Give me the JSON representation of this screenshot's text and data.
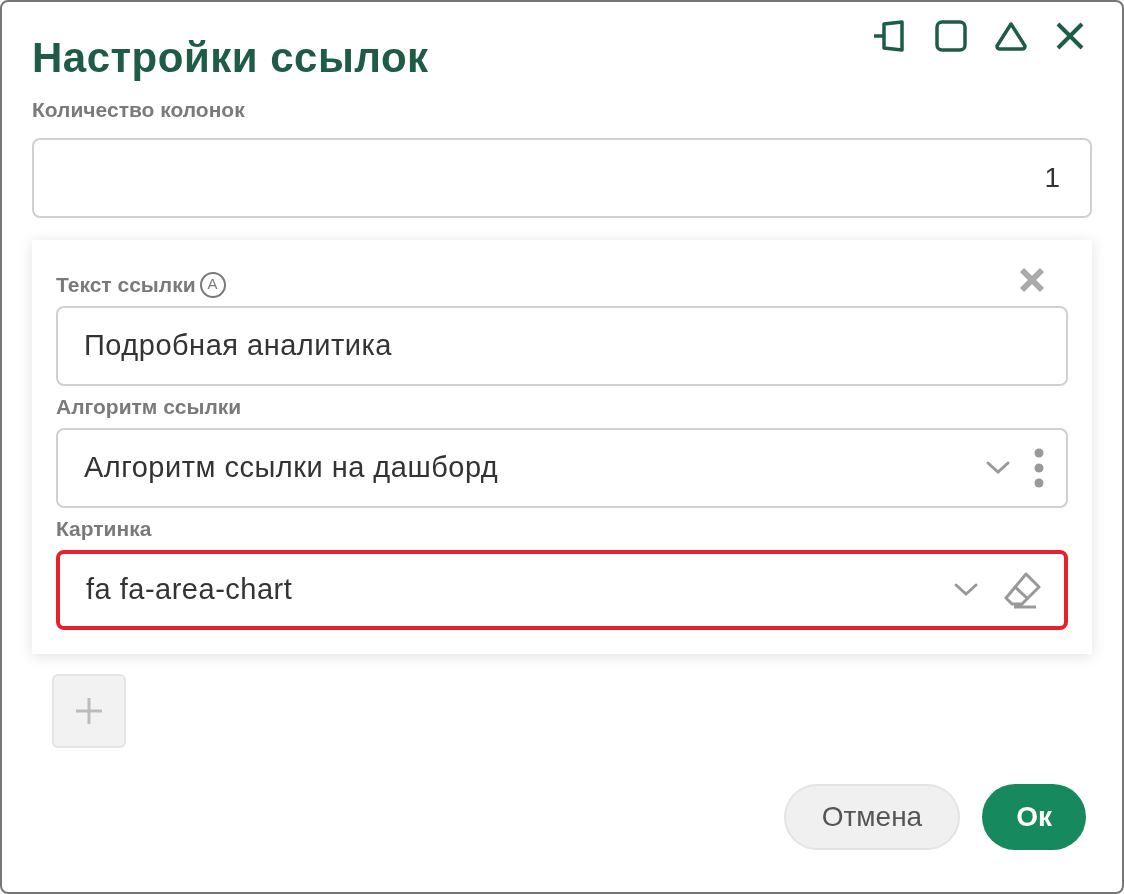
{
  "window": {
    "title": "Настройки ссылок"
  },
  "columns_field": {
    "label": "Количество колонок",
    "value": "1"
  },
  "link_card": {
    "fields": [
      {
        "kind": "text",
        "label": "Текст ссылки",
        "badge": "A",
        "value": "Подробная аналитика",
        "highlighted": false
      },
      {
        "kind": "select-menu",
        "label": "Алгоритм ссылки",
        "value": "Алгоритм ссылки на дашборд",
        "highlighted": false
      },
      {
        "kind": "select-clear",
        "label": "Картинка",
        "value": "fa fa-area-chart",
        "highlighted": true
      }
    ]
  },
  "add_button": {
    "disabled": true
  },
  "buttons": [
    {
      "label": "Отмена",
      "kind": "secondary"
    },
    {
      "label": "Ок",
      "kind": "primary"
    }
  ]
}
